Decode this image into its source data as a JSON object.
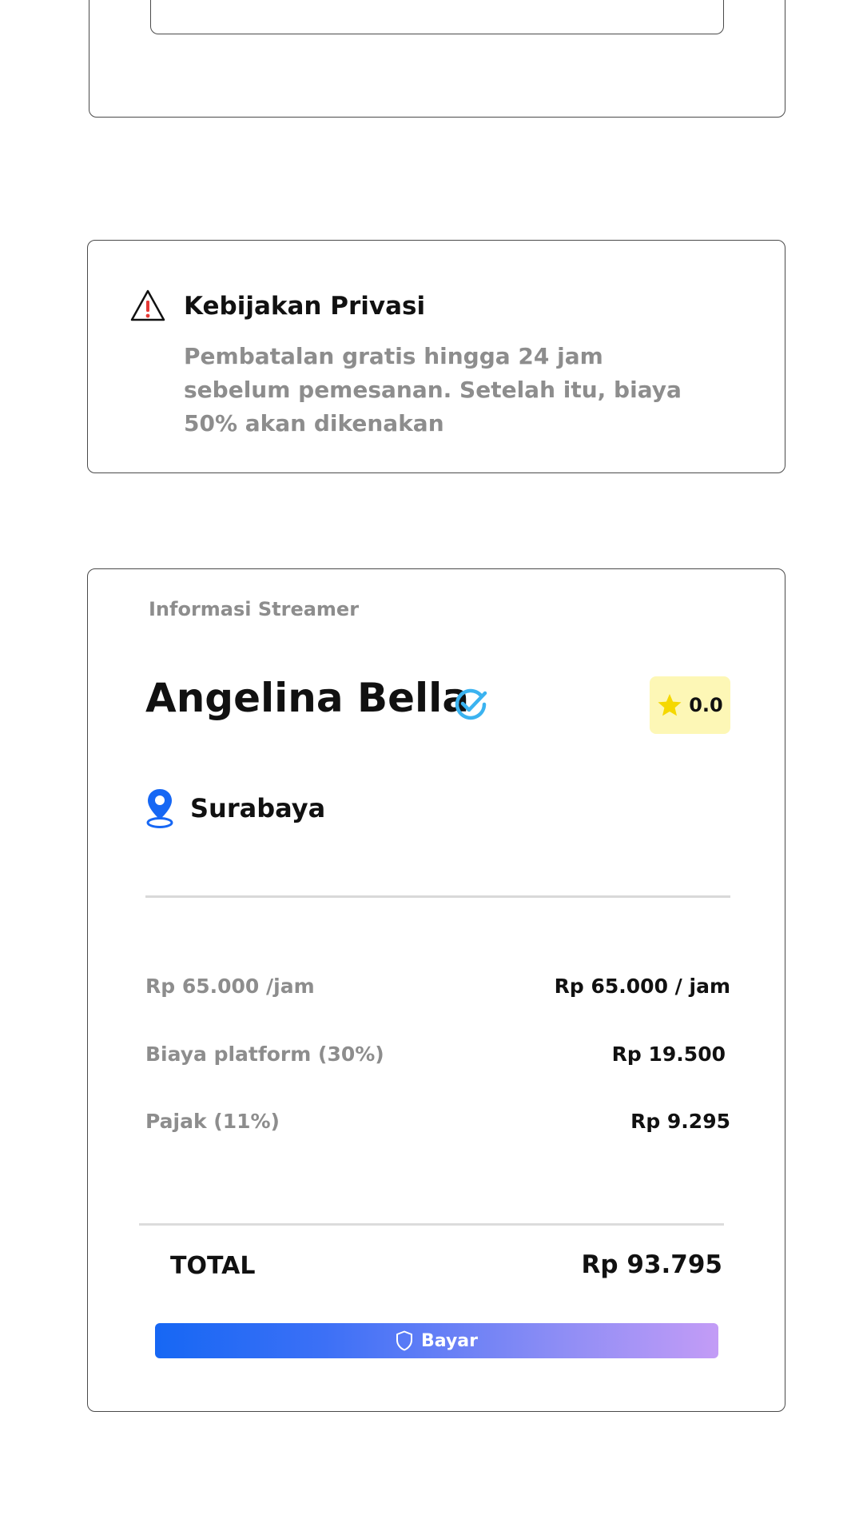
{
  "privacy": {
    "title": "Kebijakan Privasi",
    "text": "Pembatalan gratis hingga 24 jam sebelum pemesanan. Setelah itu, biaya 50% akan dikenakan",
    "icon": "warning-icon"
  },
  "streamer": {
    "section_label": "Informasi Streamer",
    "name": "Angelina Bella",
    "verified_icon": "verified-check-icon",
    "rating": "0.0",
    "location": "Surabaya"
  },
  "fees": [
    {
      "label": "Rp 65.000 /jam",
      "value": "Rp 65.000 / jam"
    },
    {
      "label": "Biaya platform (30%)",
      "value": "Rp 19.500"
    },
    {
      "label": "Pajak (11%)",
      "value": "Rp 9.295"
    }
  ],
  "total": {
    "label": "TOTAL",
    "value": "Rp 93.795"
  },
  "pay_button": {
    "label": "Bayar",
    "icon": "shield-icon"
  },
  "colors": {
    "accent_blue": "#1667f4",
    "gradient_end": "#c39cf6",
    "rating_bg": "#fdf7b6",
    "star": "#f5d800",
    "verified": "#3bb3f0",
    "warning_red": "#e53935",
    "muted_text": "#8d8d8d"
  }
}
